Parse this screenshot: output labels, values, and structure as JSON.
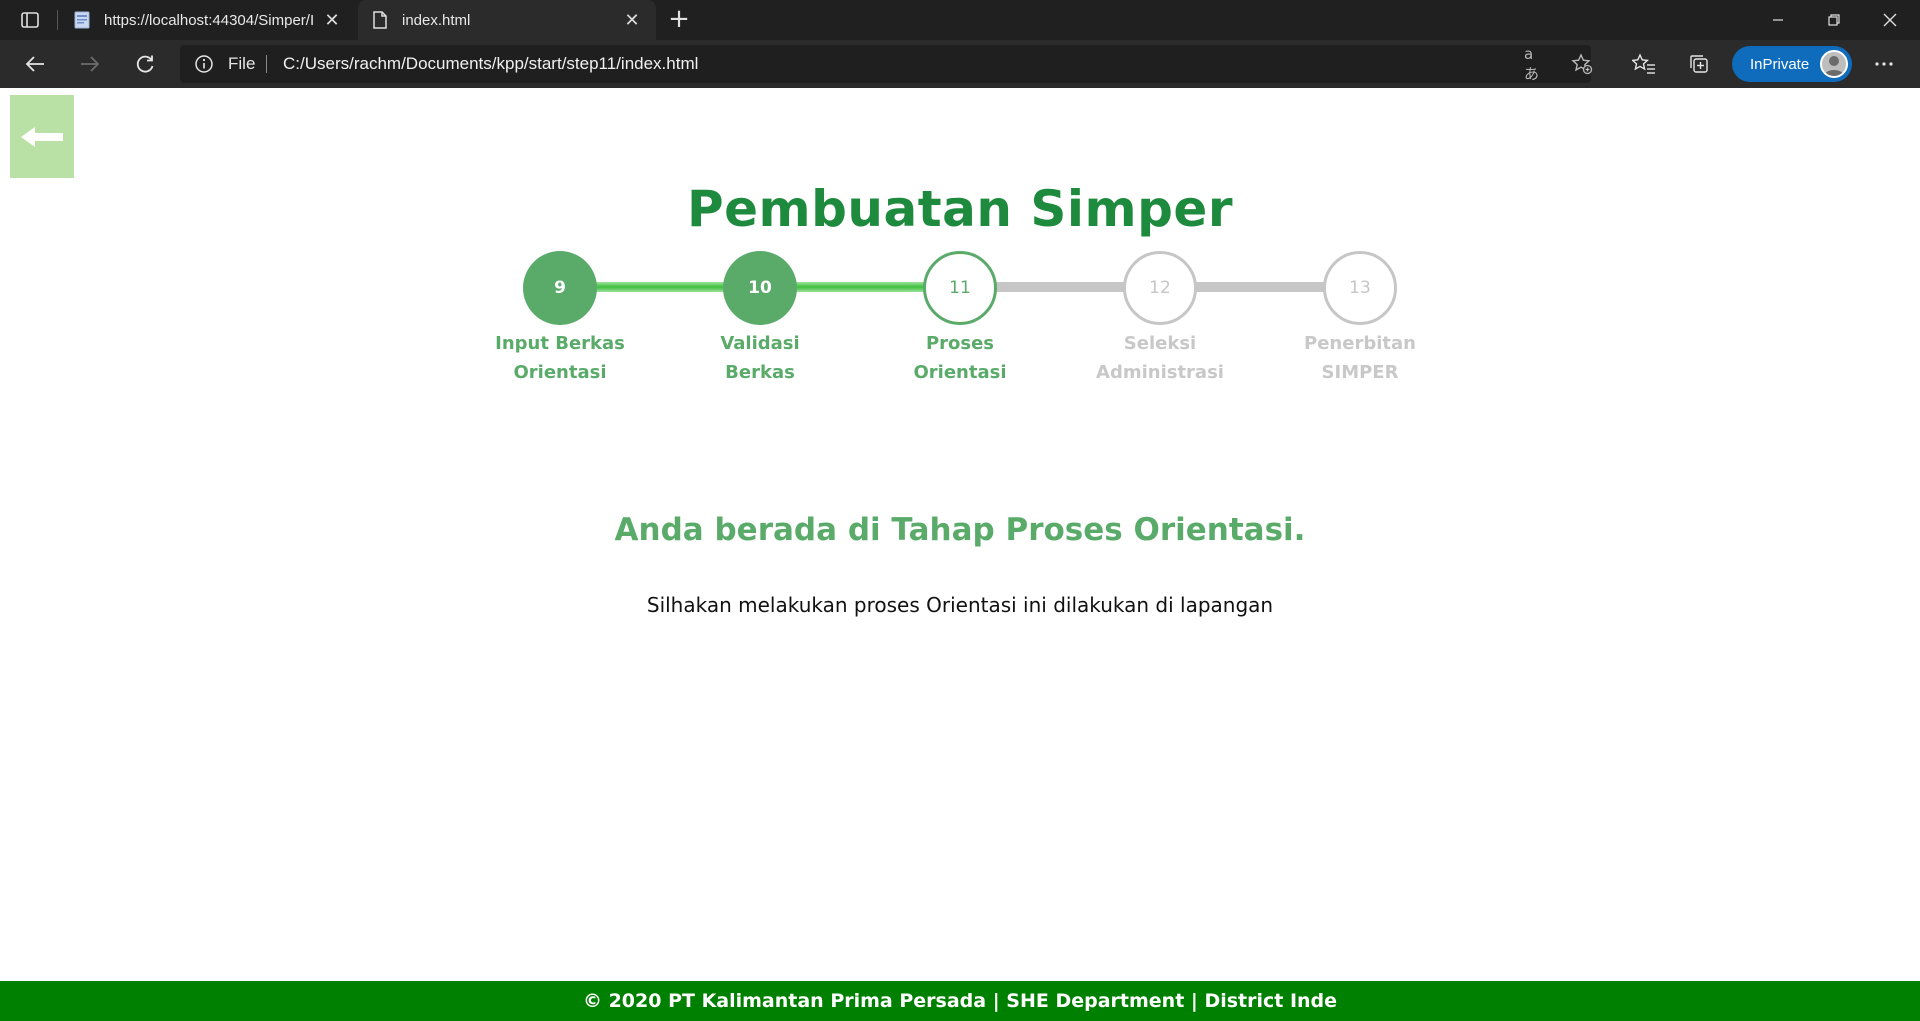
{
  "browser": {
    "tabs": [
      {
        "title": "https://localhost:44304/Simper/I",
        "active": false
      },
      {
        "title": "index.html",
        "active": true
      }
    ],
    "new_tab_label": "+",
    "address": {
      "protocol_label": "File",
      "url": "C:/Users/rachm/Documents/kpp/start/step11/index.html"
    },
    "inprivate_label": "InPrivate",
    "read_aloud_label": "aあ"
  },
  "page": {
    "title": "Pembuatan Simper",
    "steps": [
      {
        "number": "9",
        "label_line1": "Input Berkas",
        "label_line2": "Orientasi",
        "state": "done"
      },
      {
        "number": "10",
        "label_line1": "Validasi",
        "label_line2": "Berkas",
        "state": "done"
      },
      {
        "number": "11",
        "label_line1": "Proses",
        "label_line2": "Orientasi",
        "state": "active"
      },
      {
        "number": "12",
        "label_line1": "Seleksi",
        "label_line2": "Administrasi",
        "state": "todo"
      },
      {
        "number": "13",
        "label_line1": "Penerbitan",
        "label_line2": "SIMPER",
        "state": "todo"
      }
    ],
    "stage_heading": "Anda berada di Tahap Proses Orientasi.",
    "stage_description": "Silhakan melakukan proses Orientasi ini dilakukan di lapangan",
    "footer": "© 2020 PT Kalimantan Prima Persada | SHE Department | District Inde"
  },
  "colors": {
    "primary_green": "#1e8a3d",
    "step_green": "#5aab6a",
    "step_grey": "#c6c6c6",
    "footer_green": "#008000",
    "back_button": "#b9e0a5"
  }
}
